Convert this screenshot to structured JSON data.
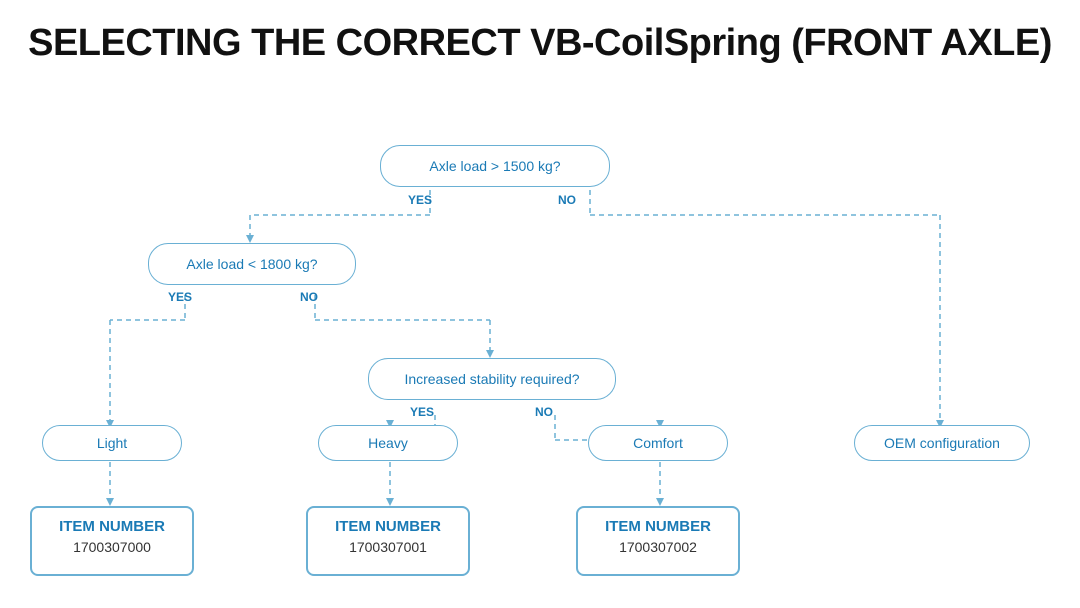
{
  "title": "SELECTING THE CORRECT VB-CoilSpring (FRONT AXLE)",
  "nodes": {
    "axleLoad1500": {
      "label": "Axle load > 1500 kg?",
      "yes": "YES",
      "no": "NO"
    },
    "axleLoad1800": {
      "label": "Axle load < 1800 kg?",
      "yes": "YES",
      "no": "NO"
    },
    "stabilityRequired": {
      "label": "Increased stability required?",
      "yes": "YES",
      "no": "NO"
    },
    "light": {
      "label": "Light"
    },
    "heavy": {
      "label": "Heavy"
    },
    "comfort": {
      "label": "Comfort"
    },
    "oem": {
      "label": "OEM configuration"
    }
  },
  "items": {
    "item0": {
      "label": "ITEM NUMBER",
      "number": "1700307000"
    },
    "item1": {
      "label": "ITEM NUMBER",
      "number": "1700307001"
    },
    "item2": {
      "label": "ITEM NUMBER",
      "number": "1700307002"
    }
  }
}
